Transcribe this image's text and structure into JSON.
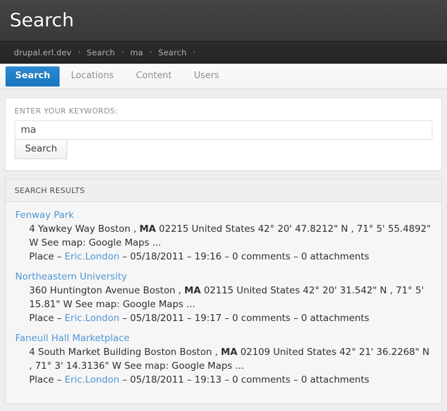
{
  "header": {
    "title": "Search"
  },
  "breadcrumb": {
    "separator": "›",
    "items": [
      {
        "label": "drupal.erl.dev"
      },
      {
        "label": "Search"
      },
      {
        "label": "ma"
      },
      {
        "label": "Search"
      }
    ]
  },
  "tabs": [
    {
      "label": "Search",
      "active": true
    },
    {
      "label": "Locations",
      "active": false
    },
    {
      "label": "Content",
      "active": false
    },
    {
      "label": "Users",
      "active": false
    }
  ],
  "search_form": {
    "label": "ENTER YOUR KEYWORDS:",
    "input_value": "ma",
    "input_placeholder": "",
    "submit_label": "Search"
  },
  "results_panel": {
    "header": "SEARCH RESULTS",
    "results": [
      {
        "title": "Fenway Park",
        "snippet_pre": "4 Yawkey Way Boston , ",
        "snippet_hl": "MA",
        "snippet_post": " 02215 United States 42° 20' 47.8212\" N , 71° 5' 55.4892\" W See map: Google Maps ...",
        "meta_type": "Place",
        "meta_sep": "–",
        "meta_author": "Eric.London",
        "meta_date": "05/18/2011",
        "meta_time": "19:16",
        "meta_comments": "0 comments",
        "meta_attachments": "0 attachments"
      },
      {
        "title": "Northeastern University",
        "snippet_pre": "360 Huntington Avenue Boston , ",
        "snippet_hl": "MA",
        "snippet_post": " 02115 United States 42° 20' 31.542\" N , 71° 5' 15.81\" W See map: Google Maps ...",
        "meta_type": "Place",
        "meta_sep": "–",
        "meta_author": "Eric.London",
        "meta_date": "05/18/2011",
        "meta_time": "19:17",
        "meta_comments": "0 comments",
        "meta_attachments": "0 attachments"
      },
      {
        "title": "Faneuil Hall Marketplace",
        "snippet_pre": "4 South Market Building Boston Boston , ",
        "snippet_hl": "MA",
        "snippet_post": " 02109 United States 42° 21' 36.2268\" N , 71° 3' 14.3136\" W See map: Google Maps ...",
        "meta_type": "Place",
        "meta_sep": "–",
        "meta_author": "Eric.London",
        "meta_date": "05/18/2011",
        "meta_time": "19:13",
        "meta_comments": "0 comments",
        "meta_attachments": "0 attachments"
      }
    ]
  },
  "colors": {
    "accent_blue": "#1976bf",
    "link_blue": "#4d96d6",
    "header_dark": "#3f3f3f",
    "breadcrumb_dark": "#282828",
    "page_bg": "#efeeee"
  }
}
